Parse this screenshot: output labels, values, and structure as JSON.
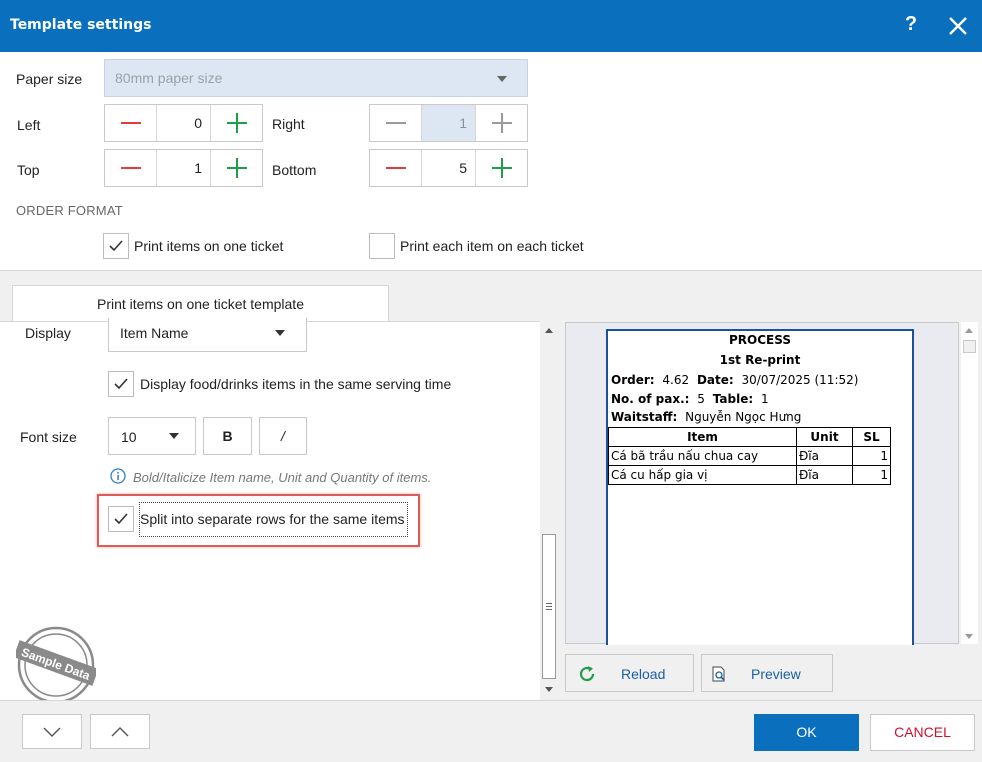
{
  "window": {
    "title": "Template settings",
    "help_label": "?"
  },
  "paper_size": {
    "label": "Paper size",
    "value": "80mm paper size"
  },
  "margins": {
    "left": {
      "label": "Left",
      "value": "0"
    },
    "right": {
      "label": "Right",
      "value": "1"
    },
    "top": {
      "label": "Top",
      "value": "1"
    },
    "bottom": {
      "label": "Bottom",
      "value": "5"
    }
  },
  "order_format": {
    "heading": "ORDER FORMAT",
    "option_one_ticket": "Print items on one ticket",
    "option_each_ticket": "Print each item on each ticket"
  },
  "tab": {
    "label": "Print items on one ticket template"
  },
  "display": {
    "label": "Display",
    "value": "Item Name"
  },
  "same_serving": {
    "label": "Display food/drinks items in the same serving time"
  },
  "font_size": {
    "label": "Font size",
    "value": "10",
    "bold_label": "B",
    "italic_label": "/"
  },
  "hint": "Bold/Italicize Item name, Unit and Quantity of items.",
  "split_rows": {
    "label": "Split into separate rows for the same items"
  },
  "stamp_text": "Sample Data",
  "preview": {
    "title": "PROCESS",
    "reprint": "1st Re-print",
    "order_label": "Order:",
    "order_value": "4.62",
    "date_label": "Date:",
    "date_value": "30/07/2025 (11:52)",
    "pax_label": "No. of pax.:",
    "pax_value": "5",
    "table_label": "Table:",
    "table_value": "1",
    "waitstaff_label": "Waitstaff:",
    "waitstaff_value": "Nguyễn Ngọc Hưng",
    "columns": {
      "item": "Item",
      "unit": "Unit",
      "qty": "SL"
    },
    "rows": [
      {
        "item": "Cá bã trầu nấu chua cay",
        "unit": "Đĩa",
        "qty": "1"
      },
      {
        "item": "Cá cu hấp gia vị",
        "unit": "Đĩa",
        "qty": "1"
      }
    ]
  },
  "buttons": {
    "reload": "Reload",
    "preview": "Preview",
    "ok": "OK",
    "cancel": "CANCEL"
  },
  "colors": {
    "title_bar": "#0a70be",
    "ok": "#0a70be",
    "cancel_text": "#d0112b",
    "highlight": "#e05a5a"
  }
}
